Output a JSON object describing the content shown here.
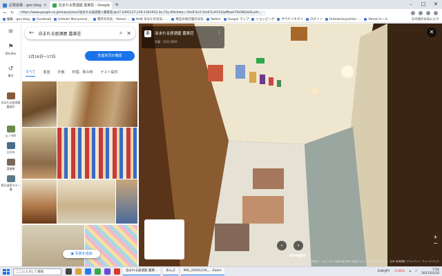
{
  "browser": {
    "tabs": [
      {
        "label": "記事投稿 - goo blog",
        "color": "#3a7bd5"
      },
      {
        "label": "泊まれる居酒屋 嘉楽荘 - Google",
        "color": "#34a853"
      }
    ],
    "url": "https://www.google.co.jp/maps/place/泊まれる居酒屋+嘉楽荘/@37.2491127,139.1361952,3a,75y,90t/data=!3m8!1e1!3m6!1sAF1QipMkwxT9d3N2wGLuAc...",
    "bookmarks": [
      "編集 - goo blog",
      "Facebook",
      "Hideaki Moriyama(...",
      "東京の天気 - Yahoo!...",
      "NHK あなたの天気・...",
      "埼玉の地方版の天気",
      "Twitter",
      "Google マップ",
      "ショッピング",
      "サウナイキタイ",
      "ログイン",
      "Hideakimiyashita -...",
      "Yahoo!メール"
    ],
    "bookmarks_right": "その他のお気に入り"
  },
  "rail": {
    "menu_icon": "menu-icon",
    "items": [
      {
        "label": "保存済み",
        "icon": "bookmark-icon"
      },
      {
        "label": "最近",
        "icon": "history-icon"
      }
    ],
    "recent": [
      {
        "label": "泊まれる居酒屋 嘉楽荘",
        "color": "#8a5a3a"
      },
      {
        "label": "山ノ内町",
        "color": "#6d8a4a"
      },
      {
        "label": "日光市",
        "color": "#4a6d8a"
      },
      {
        "label": "湯檜曽",
        "color": "#7a6a5a"
      },
      {
        "label": "野沢温泉スキー場",
        "color": "#5a7a8a"
      }
    ]
  },
  "panel": {
    "search_query": "泊まれる居酒屋 嘉楽荘",
    "dates": "1月16日〜17日",
    "availability_button": "空室状況の確認",
    "subtabs": [
      "すべて",
      "客室",
      "外観",
      "料理、飲み物",
      "ゲスト提供"
    ],
    "add_photo": "写真を追加"
  },
  "streetview": {
    "title": "泊まれる居酒屋 嘉楽荘",
    "date": "写真 - 12月 2020",
    "a_label": "あ",
    "google": "Google",
    "footer": "画像の撮影日: 12月 2020   画像は著作権で保護されている場合があります。   日本   利用規約   プライバシー   フィードバック"
  },
  "taskbar": {
    "search_placeholder": "ここに入力して検索",
    "apps": [
      "泊まれる居酒屋 嘉楽...",
      "あんぷ",
      "IMG_20201230_...  Zoom"
    ],
    "tray": {
      "currency": "EUR/JPY",
      "change": "-0.06%",
      "time": "7:50",
      "date": "2021/01/10"
    }
  }
}
